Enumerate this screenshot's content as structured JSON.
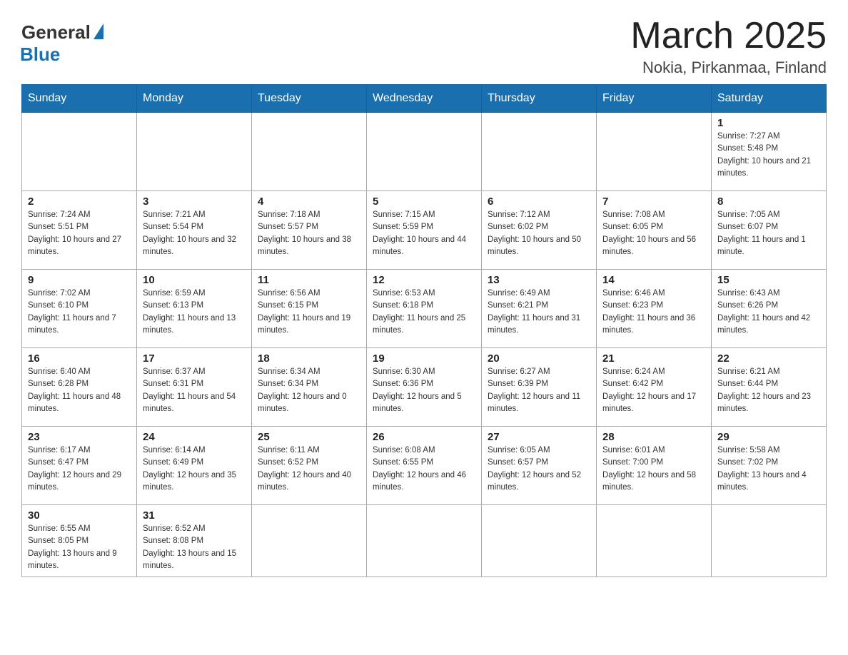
{
  "header": {
    "logo_general": "General",
    "logo_blue": "Blue",
    "month_title": "March 2025",
    "location": "Nokia, Pirkanmaa, Finland"
  },
  "weekdays": [
    "Sunday",
    "Monday",
    "Tuesday",
    "Wednesday",
    "Thursday",
    "Friday",
    "Saturday"
  ],
  "weeks": [
    [
      null,
      null,
      null,
      null,
      null,
      null,
      {
        "day": 1,
        "sunrise": "7:27 AM",
        "sunset": "5:48 PM",
        "daylight": "10 hours and 21 minutes."
      }
    ],
    [
      {
        "day": 2,
        "sunrise": "7:24 AM",
        "sunset": "5:51 PM",
        "daylight": "10 hours and 27 minutes."
      },
      {
        "day": 3,
        "sunrise": "7:21 AM",
        "sunset": "5:54 PM",
        "daylight": "10 hours and 32 minutes."
      },
      {
        "day": 4,
        "sunrise": "7:18 AM",
        "sunset": "5:57 PM",
        "daylight": "10 hours and 38 minutes."
      },
      {
        "day": 5,
        "sunrise": "7:15 AM",
        "sunset": "5:59 PM",
        "daylight": "10 hours and 44 minutes."
      },
      {
        "day": 6,
        "sunrise": "7:12 AM",
        "sunset": "6:02 PM",
        "daylight": "10 hours and 50 minutes."
      },
      {
        "day": 7,
        "sunrise": "7:08 AM",
        "sunset": "6:05 PM",
        "daylight": "10 hours and 56 minutes."
      },
      {
        "day": 8,
        "sunrise": "7:05 AM",
        "sunset": "6:07 PM",
        "daylight": "11 hours and 1 minute."
      }
    ],
    [
      {
        "day": 9,
        "sunrise": "7:02 AM",
        "sunset": "6:10 PM",
        "daylight": "11 hours and 7 minutes."
      },
      {
        "day": 10,
        "sunrise": "6:59 AM",
        "sunset": "6:13 PM",
        "daylight": "11 hours and 13 minutes."
      },
      {
        "day": 11,
        "sunrise": "6:56 AM",
        "sunset": "6:15 PM",
        "daylight": "11 hours and 19 minutes."
      },
      {
        "day": 12,
        "sunrise": "6:53 AM",
        "sunset": "6:18 PM",
        "daylight": "11 hours and 25 minutes."
      },
      {
        "day": 13,
        "sunrise": "6:49 AM",
        "sunset": "6:21 PM",
        "daylight": "11 hours and 31 minutes."
      },
      {
        "day": 14,
        "sunrise": "6:46 AM",
        "sunset": "6:23 PM",
        "daylight": "11 hours and 36 minutes."
      },
      {
        "day": 15,
        "sunrise": "6:43 AM",
        "sunset": "6:26 PM",
        "daylight": "11 hours and 42 minutes."
      }
    ],
    [
      {
        "day": 16,
        "sunrise": "6:40 AM",
        "sunset": "6:28 PM",
        "daylight": "11 hours and 48 minutes."
      },
      {
        "day": 17,
        "sunrise": "6:37 AM",
        "sunset": "6:31 PM",
        "daylight": "11 hours and 54 minutes."
      },
      {
        "day": 18,
        "sunrise": "6:34 AM",
        "sunset": "6:34 PM",
        "daylight": "12 hours and 0 minutes."
      },
      {
        "day": 19,
        "sunrise": "6:30 AM",
        "sunset": "6:36 PM",
        "daylight": "12 hours and 5 minutes."
      },
      {
        "day": 20,
        "sunrise": "6:27 AM",
        "sunset": "6:39 PM",
        "daylight": "12 hours and 11 minutes."
      },
      {
        "day": 21,
        "sunrise": "6:24 AM",
        "sunset": "6:42 PM",
        "daylight": "12 hours and 17 minutes."
      },
      {
        "day": 22,
        "sunrise": "6:21 AM",
        "sunset": "6:44 PM",
        "daylight": "12 hours and 23 minutes."
      }
    ],
    [
      {
        "day": 23,
        "sunrise": "6:17 AM",
        "sunset": "6:47 PM",
        "daylight": "12 hours and 29 minutes."
      },
      {
        "day": 24,
        "sunrise": "6:14 AM",
        "sunset": "6:49 PM",
        "daylight": "12 hours and 35 minutes."
      },
      {
        "day": 25,
        "sunrise": "6:11 AM",
        "sunset": "6:52 PM",
        "daylight": "12 hours and 40 minutes."
      },
      {
        "day": 26,
        "sunrise": "6:08 AM",
        "sunset": "6:55 PM",
        "daylight": "12 hours and 46 minutes."
      },
      {
        "day": 27,
        "sunrise": "6:05 AM",
        "sunset": "6:57 PM",
        "daylight": "12 hours and 52 minutes."
      },
      {
        "day": 28,
        "sunrise": "6:01 AM",
        "sunset": "7:00 PM",
        "daylight": "12 hours and 58 minutes."
      },
      {
        "day": 29,
        "sunrise": "5:58 AM",
        "sunset": "7:02 PM",
        "daylight": "13 hours and 4 minutes."
      }
    ],
    [
      {
        "day": 30,
        "sunrise": "6:55 AM",
        "sunset": "8:05 PM",
        "daylight": "13 hours and 9 minutes."
      },
      {
        "day": 31,
        "sunrise": "6:52 AM",
        "sunset": "8:08 PM",
        "daylight": "13 hours and 15 minutes."
      },
      null,
      null,
      null,
      null,
      null
    ]
  ],
  "labels": {
    "sunrise": "Sunrise:",
    "sunset": "Sunset:",
    "daylight": "Daylight:"
  }
}
